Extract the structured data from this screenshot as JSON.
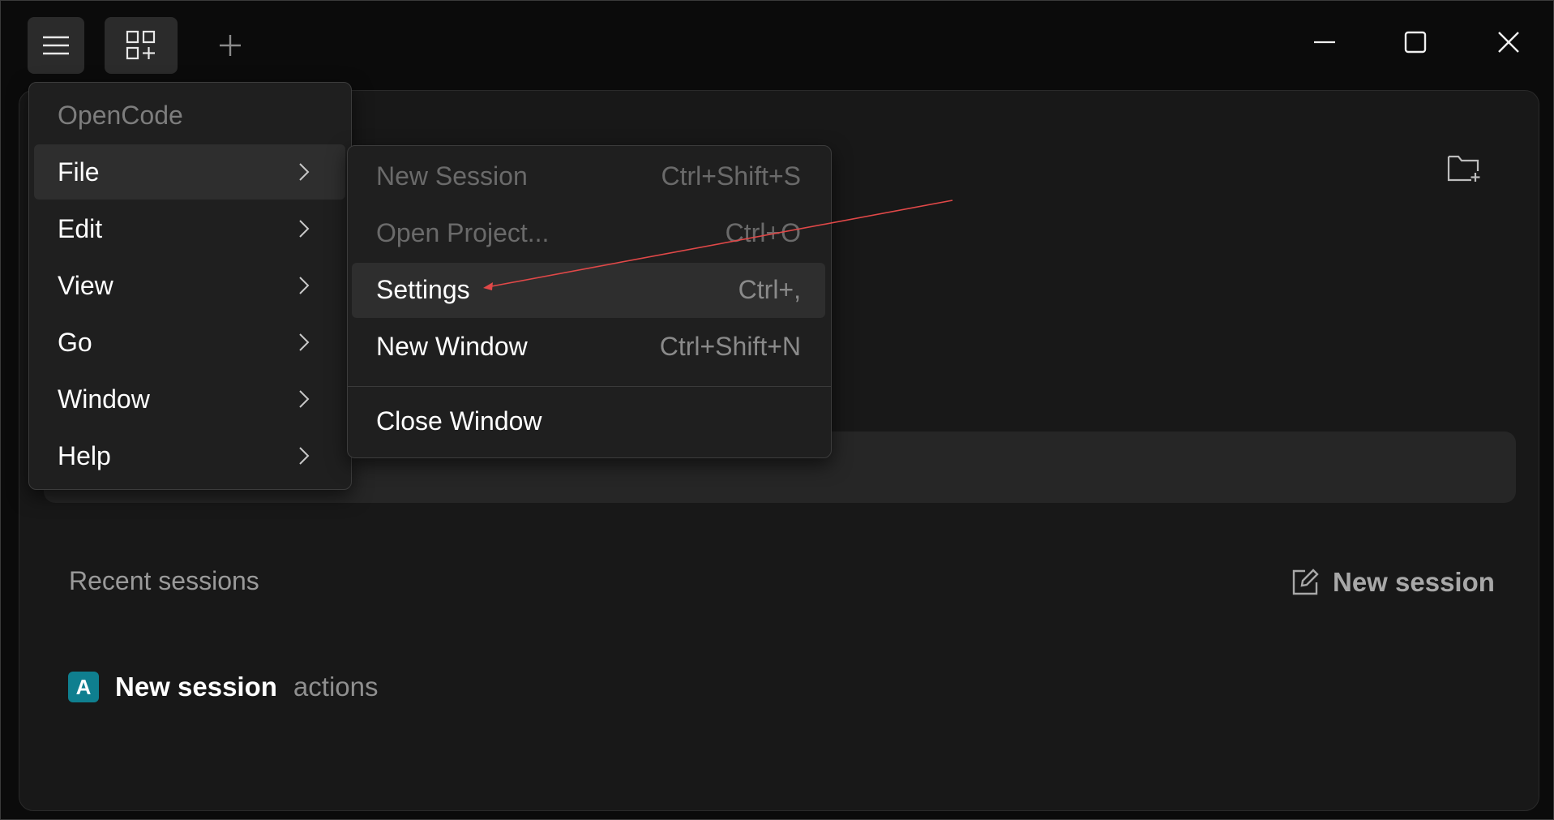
{
  "titlebar": {
    "menu_icon": "hamburger-icon",
    "apps_icon": "apps-add-icon",
    "add_icon": "plus-icon",
    "window_controls": [
      "minimize-icon",
      "maximize-icon",
      "close-icon"
    ]
  },
  "main": {
    "folder_icon": "new-folder-icon",
    "recent_title": "Recent sessions",
    "new_session_label": "New session",
    "sessions": [
      {
        "badge": "A",
        "title": "New session",
        "subtitle": "actions"
      }
    ]
  },
  "menu": {
    "header": "OpenCode",
    "items": [
      {
        "label": "File"
      },
      {
        "label": "Edit"
      },
      {
        "label": "View"
      },
      {
        "label": "Go"
      },
      {
        "label": "Window"
      },
      {
        "label": "Help"
      }
    ]
  },
  "submenu": {
    "items": [
      {
        "label": "New Session",
        "shortcut": "Ctrl+Shift+S"
      },
      {
        "label": "Open Project...",
        "shortcut": "Ctrl+O"
      },
      {
        "label": "Settings",
        "shortcut": "Ctrl+,"
      },
      {
        "label": "New Window",
        "shortcut": "Ctrl+Shift+N"
      },
      {
        "label": "Close Window",
        "shortcut": ""
      }
    ]
  },
  "colors": {
    "background": "#0b0b0b",
    "panel": "#181818",
    "menu": "#1f1f1f",
    "highlight": "#2e2e2e",
    "badge": "#0f7f8f",
    "annotation": "#e04848"
  }
}
